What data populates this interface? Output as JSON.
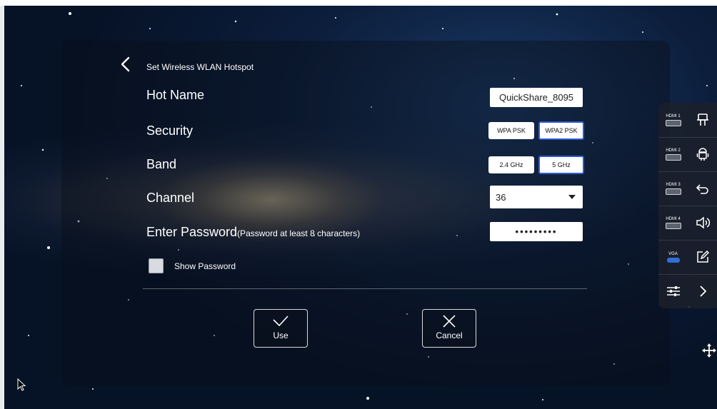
{
  "dialog": {
    "title": "Set Wireless WLAN Hotspot"
  },
  "form": {
    "hot_name": {
      "label": "Hot Name",
      "value": "QuickShare_8095"
    },
    "security": {
      "label": "Security",
      "options": [
        "WPA PSK",
        "WPA2 PSK"
      ],
      "selected": "WPA2 PSK"
    },
    "band": {
      "label": "Band",
      "options": [
        "2.4 GHz",
        "5 GHz"
      ],
      "selected": "5 GHz"
    },
    "channel": {
      "label": "Channel",
      "value": "36"
    },
    "password": {
      "label": "Enter Password",
      "hint": "(Password at least 8 characters)",
      "value": "•••••••••"
    },
    "show_password": {
      "label": "Show Password",
      "checked": false
    }
  },
  "actions": {
    "use_label": "Use",
    "cancel_label": "Cancel"
  },
  "sidebar": {
    "sources": [
      "HDMI 1",
      "HDMI 2",
      "HDMI 3",
      "HDMI 4",
      "VGA"
    ],
    "icons": [
      "tools-icon",
      "android-icon",
      "back-icon",
      "volume-icon",
      "annotate-icon",
      "expand-icon",
      "settings-sliders-icon",
      "move-icon"
    ]
  },
  "colors": {
    "accent": "#2d5bd6",
    "text": "#ffffff"
  }
}
